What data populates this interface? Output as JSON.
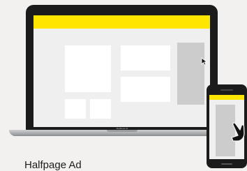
{
  "caption": "Halfpage Ad",
  "laptop_brand": "MacBook Air",
  "colors": {
    "background": "#f2f1ef",
    "device_frame": "#1b1b1b",
    "screen_bg": "#efefef",
    "header_accent": "#ffe600",
    "content_block": "#ffffff",
    "ad_slot": "#cccccc"
  },
  "icons": {
    "cursor": "cursor-arrow-icon",
    "touch": "hand-touch-icon"
  }
}
